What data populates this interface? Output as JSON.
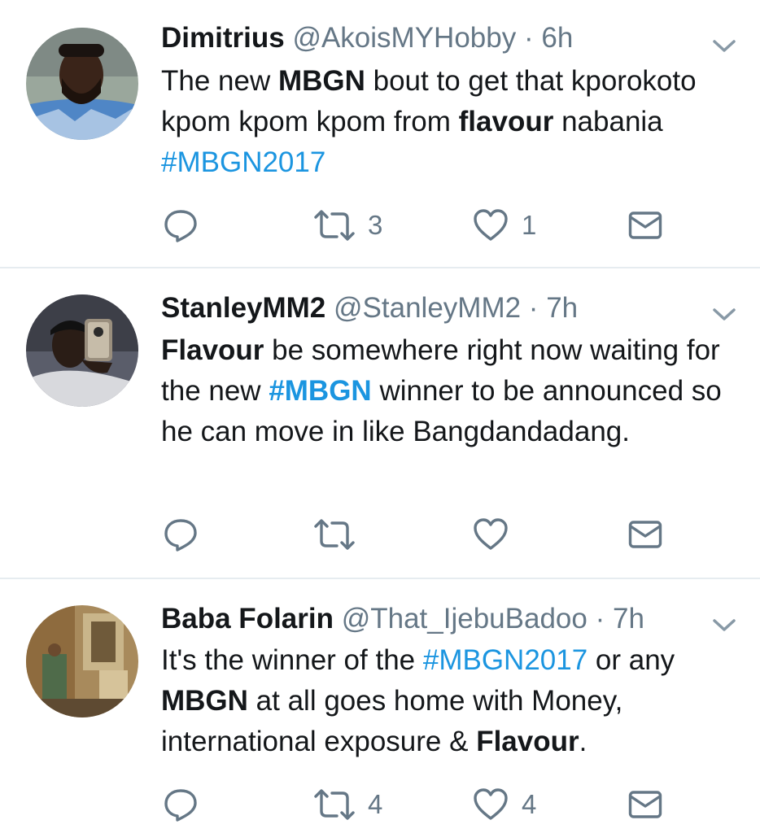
{
  "tweets": [
    {
      "name": "Dimitrius",
      "handle": "@AkoisMYHobby",
      "separator": "·",
      "time": "6h",
      "text": [
        {
          "t": "The new ",
          "s": "plain"
        },
        {
          "t": "MBGN",
          "s": "bold"
        },
        {
          "t": " bout to get that kporokoto kpom kpom kpom from ",
          "s": "plain"
        },
        {
          "t": "flavour",
          "s": "bold"
        },
        {
          "t": " nabania ",
          "s": "plain"
        },
        {
          "t": "#MBGN2017",
          "s": "hashtag"
        }
      ],
      "retweet_count": "3",
      "like_count": "1"
    },
    {
      "name": "StanleyMM2",
      "handle": "@StanleyMM2",
      "separator": "·",
      "time": "7h",
      "text": [
        {
          "t": "Flavour",
          "s": "bold"
        },
        {
          "t": " be somewhere right now waiting for the new ",
          "s": "plain"
        },
        {
          "t": "#MBGN",
          "s": "hashtag-bold"
        },
        {
          "t": " winner to be announced so he can move in like Bangdandadang.",
          "s": "plain"
        }
      ],
      "retweet_count": "",
      "like_count": ""
    },
    {
      "name": "Baba Folarin",
      "handle": "@That_IjebuBadoo",
      "separator": "·",
      "time": "7h",
      "text": [
        {
          "t": "It's the winner of the ",
          "s": "plain"
        },
        {
          "t": "#MBGN2017",
          "s": "hashtag"
        },
        {
          "t": " or any ",
          "s": "plain"
        },
        {
          "t": "MBGN",
          "s": "bold"
        },
        {
          "t": " at all goes home with Money, international exposure & ",
          "s": "plain"
        },
        {
          "t": "Flavour",
          "s": "bold"
        },
        {
          "t": ".",
          "s": "plain"
        }
      ],
      "retweet_count": "4",
      "like_count": "4"
    }
  ],
  "icons": {
    "reply": "reply-icon",
    "retweet": "retweet-icon",
    "like": "heart-icon",
    "dm": "envelope-icon",
    "more": "chevron-down-icon"
  },
  "colors": {
    "text": "#14171a",
    "secondary": "#657786",
    "link": "#1b95e0",
    "divider": "#e6ecf0"
  }
}
